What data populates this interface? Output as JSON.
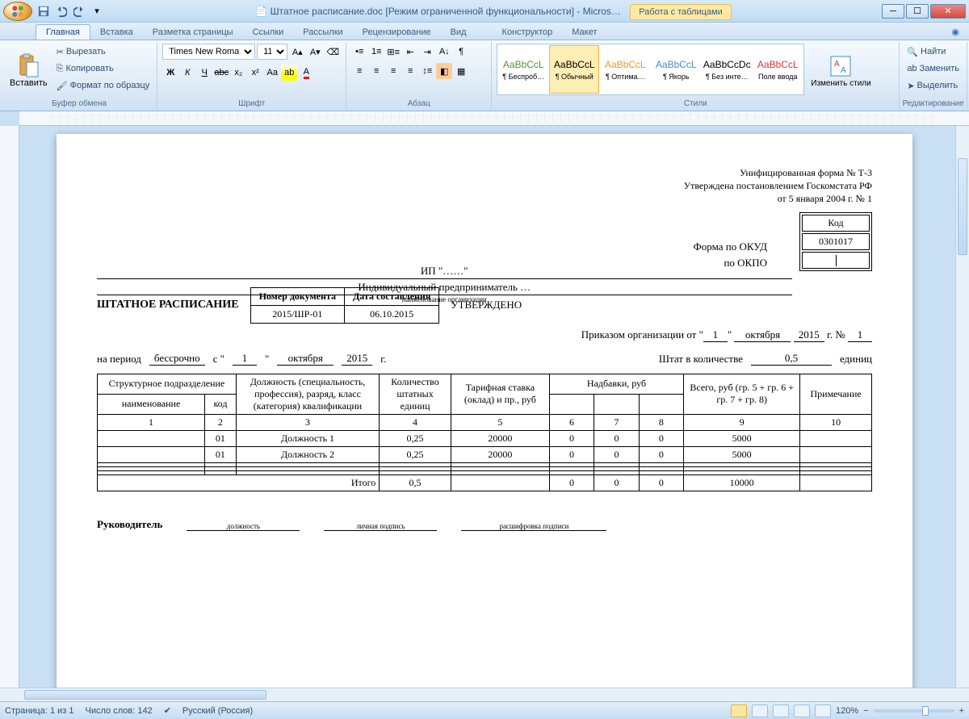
{
  "title": "Штатное расписание.doc [Режим ограниченной функциональности] - Micros…",
  "context_tab_group": "Работа с таблицами",
  "tabs": [
    "Главная",
    "Вставка",
    "Разметка страницы",
    "Ссылки",
    "Рассылки",
    "Рецензирование",
    "Вид",
    "Конструктор",
    "Макет"
  ],
  "ribbon": {
    "paste": "Вставить",
    "cut": "Вырезать",
    "copy": "Копировать",
    "format_painter": "Формат по образцу",
    "clipboard_group": "Буфер обмена",
    "font_name": "Times New Roman",
    "font_size": "11",
    "font_group": "Шрифт",
    "paragraph_group": "Абзац",
    "styles_group": "Стили",
    "change_styles": "Изменить стили",
    "editing_group": "Редактирование",
    "find": "Найти",
    "replace": "Заменить",
    "select": "Выделить",
    "styles": [
      {
        "preview": "AaBbCcL",
        "name": "¶ Беспроб…",
        "color": "#5d8f3e"
      },
      {
        "preview": "AaBbCcL",
        "name": "¶ Обычный",
        "color": "#000",
        "active": true
      },
      {
        "preview": "AaBbCcL",
        "name": "¶ Оптима…",
        "color": "#e89a2a"
      },
      {
        "preview": "AaBbCcL",
        "name": "¶ Якорь",
        "color": "#4b89c8"
      },
      {
        "preview": "AaBbCcDc",
        "name": "¶ Без инте…",
        "color": "#000"
      },
      {
        "preview": "AaBbCcL",
        "name": "Поле ввода",
        "color": "#d33"
      }
    ]
  },
  "doc": {
    "form_lines": [
      "Унифицированная форма № Т-3",
      "Утверждена постановлением Госкомстата РФ",
      "от 5 января 2004 г. № 1"
    ],
    "code_header": "Код",
    "okud_label": "Форма по ОКУД",
    "okud_value": "0301017",
    "okpo_label": "по ОКПО",
    "okpo_value": "",
    "org_line1": "ИП \"……\"",
    "org_line2": "Индивидуальный предприниматель …",
    "org_caption": "наименование организации",
    "title": "ШТАТНОЕ РАСПИСАНИЕ",
    "doc_no_label": "Номер документа",
    "doc_date_label": "Дата составления",
    "doc_no": "2015/ШР-01",
    "doc_date": "06.10.2015",
    "approved": "УТВЕРЖДЕНО",
    "order_text_1": "Приказом организации от \"",
    "order_day": "1",
    "order_text_2": "\" ",
    "order_month": "октября",
    "order_year": "2015",
    "order_text_3": " г.  №",
    "order_no": "1",
    "period_label": "на период",
    "period_value": "бессрочно",
    "period_from_1": "с \"",
    "period_from_day": "1",
    "period_from_2": "\" ",
    "period_from_month": "октября",
    "period_from_year": "2015",
    "period_from_3": " г.",
    "staff_label": "Штат в количестве",
    "staff_value": "0,5",
    "staff_units": "единиц",
    "headers": {
      "struct": "Структурное подразделение",
      "name": "наименование",
      "code": "код",
      "position": "Должность (специальность, профессия), разряд, класс (категория) квалификации",
      "count": "Количество штатных единиц",
      "rate": "Тарифная ставка (оклад) и пр., руб",
      "allow": "Надбавки, руб",
      "total": "Всего, руб (гр. 5 + гр. 6 + гр. 7 + гр. 8)",
      "note": "Примечание"
    },
    "colnums": [
      "1",
      "2",
      "3",
      "4",
      "5",
      "6",
      "7",
      "8",
      "9",
      "10"
    ],
    "rows": [
      {
        "name": "",
        "code": "01",
        "pos": "Должность 1",
        "cnt": "0,25",
        "rate": "20000",
        "a1": "0",
        "a2": "0",
        "a3": "0",
        "tot": "5000",
        "note": ""
      },
      {
        "name": "",
        "code": "01",
        "pos": "Должность 2",
        "cnt": "0,25",
        "rate": "20000",
        "a1": "0",
        "a2": "0",
        "a3": "0",
        "tot": "5000",
        "note": ""
      }
    ],
    "itogo": "Итого",
    "sum": {
      "cnt": "0,5",
      "a1": "0",
      "a2": "0",
      "a3": "0",
      "tot": "10000"
    },
    "leader": "Руководитель",
    "sig1": "должность",
    "sig2": "личная подпись",
    "sig3": "расшифровка подписи"
  },
  "status": {
    "page": "Страница: 1 из 1",
    "words": "Число слов: 142",
    "lang": "Русский (Россия)",
    "zoom": "120%"
  }
}
